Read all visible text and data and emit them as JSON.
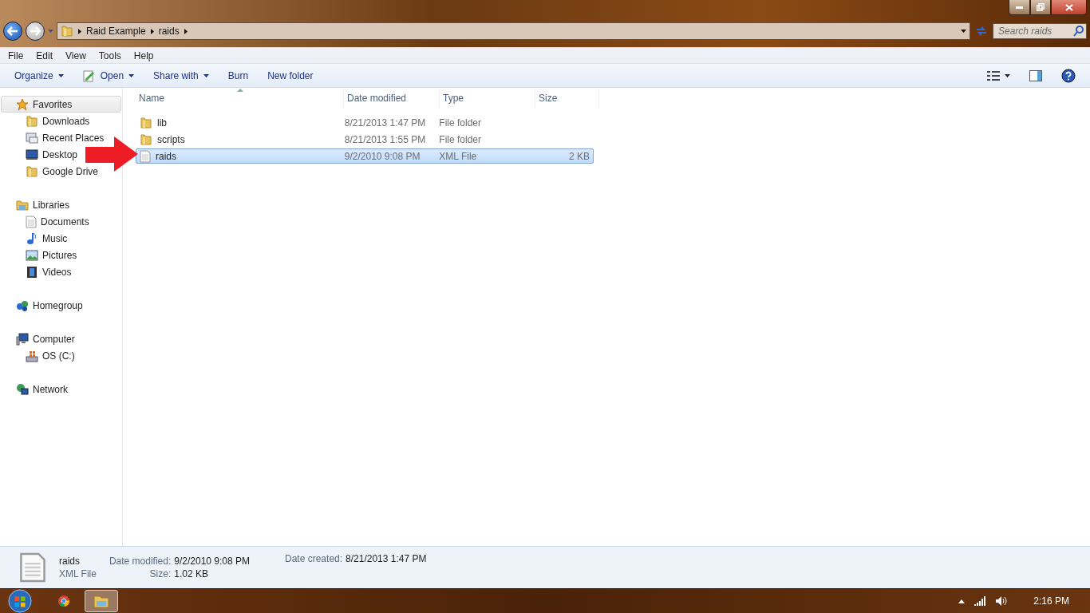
{
  "address_bar": {
    "breadcrumbs": [
      "Raid Example",
      "raids"
    ]
  },
  "search": {
    "placeholder": "Search raids"
  },
  "menu": [
    "File",
    "Edit",
    "View",
    "Tools",
    "Help"
  ],
  "toolbar": [
    {
      "label": "Organize",
      "kind": "dropdown"
    },
    {
      "label": "Open",
      "kind": "open"
    },
    {
      "label": "Share with",
      "kind": "dropdown"
    },
    {
      "label": "Burn",
      "kind": "plain"
    },
    {
      "label": "New folder",
      "kind": "plain"
    }
  ],
  "sidebar": [
    {
      "label": "Favorites",
      "selected": true,
      "children": [
        {
          "label": "Downloads",
          "selected": false
        },
        {
          "label": "Recent Places",
          "selected": false
        },
        {
          "label": "Desktop",
          "selected": false
        },
        {
          "label": "Google Drive",
          "selected": false
        }
      ]
    },
    {
      "label": "Libraries",
      "selected": false,
      "children": [
        {
          "label": "Documents",
          "selected": false
        },
        {
          "label": "Music",
          "selected": false
        },
        {
          "label": "Pictures",
          "selected": false
        },
        {
          "label": "Videos",
          "selected": false
        }
      ]
    },
    {
      "label": "Homegroup",
      "selected": false
    },
    {
      "label": "Computer",
      "selected": false,
      "children": [
        {
          "label": "OS (C:)",
          "selected": false
        }
      ]
    },
    {
      "label": "Network",
      "selected": false
    }
  ],
  "table": {
    "columns": [
      {
        "label": "Name",
        "sorted": true
      },
      {
        "label": "Date modified",
        "sorted": false
      },
      {
        "label": "Type",
        "sorted": false
      },
      {
        "label": "Size",
        "sorted": false
      }
    ],
    "rows": [
      {
        "name": "lib",
        "kind": "folder",
        "date": "8/21/2013 1:47 PM",
        "type": "File folder",
        "selected": false
      },
      {
        "name": "scripts",
        "kind": "folder",
        "date": "8/21/2013 1:55 PM",
        "type": "File folder",
        "selected": false
      },
      {
        "name": "raids",
        "kind": "file",
        "date": "9/2/2010 9:08 PM",
        "type": "XML File",
        "size": "2 KB",
        "selected": true
      }
    ]
  },
  "details": {
    "name": "raids",
    "type": "XML File",
    "fields": [
      {
        "label": "Date modified:",
        "value": "9/2/2010 9:08 PM"
      },
      {
        "label": "Size:",
        "value": "1.02 KB"
      },
      {
        "label": "Date created:",
        "value": "8/21/2013 1:47 PM"
      }
    ]
  },
  "taskbar": {
    "apps": [
      {
        "kind": "chrome",
        "selected": false
      },
      {
        "kind": "explorer",
        "selected": true
      }
    ],
    "clock": "2:16 PM"
  }
}
